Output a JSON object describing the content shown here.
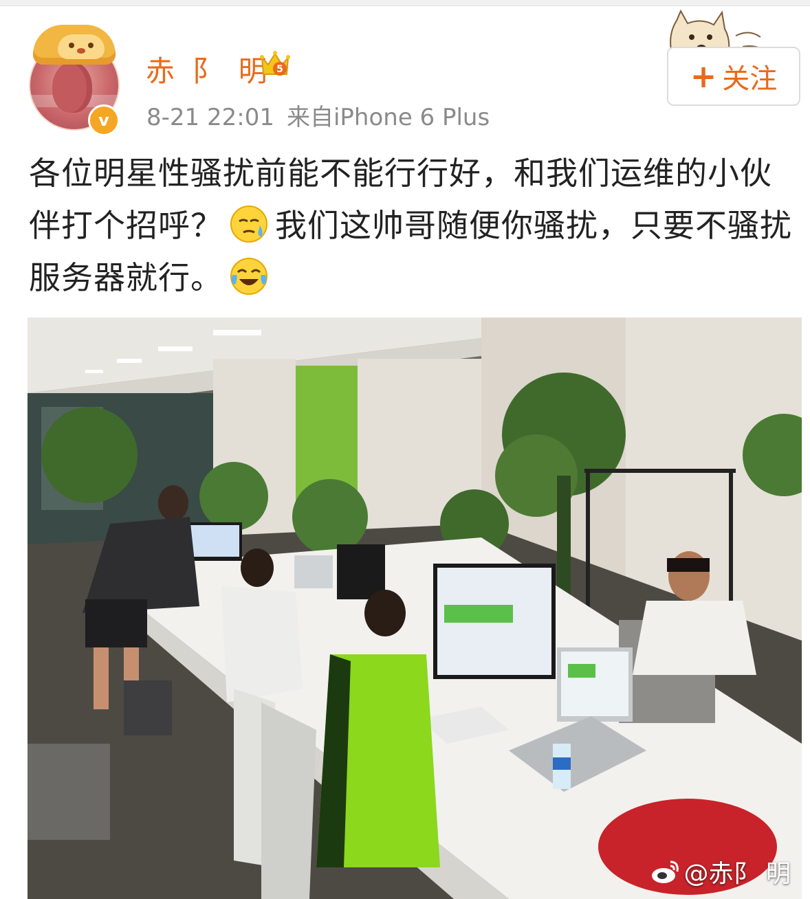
{
  "post": {
    "username": "赤 阝 明",
    "vip_level": "5",
    "date": "8-21 22:01",
    "source": "来自iPhone 6 Plus",
    "follow_label": "关注",
    "follow_plus": "+",
    "verified_badge": "v",
    "text_part1": "各位明星性骚扰前能不能行行好，和我们运维的小伙伴打个招呼？",
    "text_part2": "我们这帅哥随便你骚扰，只要不骚扰服务器就行。",
    "emoji1": "sweat-face-icon",
    "emoji2": "tears-of-joy-icon"
  },
  "photo": {
    "description_icon": "office-photo",
    "watermark": "@赤阝 明"
  },
  "colors": {
    "accent": "#e96a1b",
    "meta_gray": "#8a8a8a",
    "text": "#222222"
  }
}
